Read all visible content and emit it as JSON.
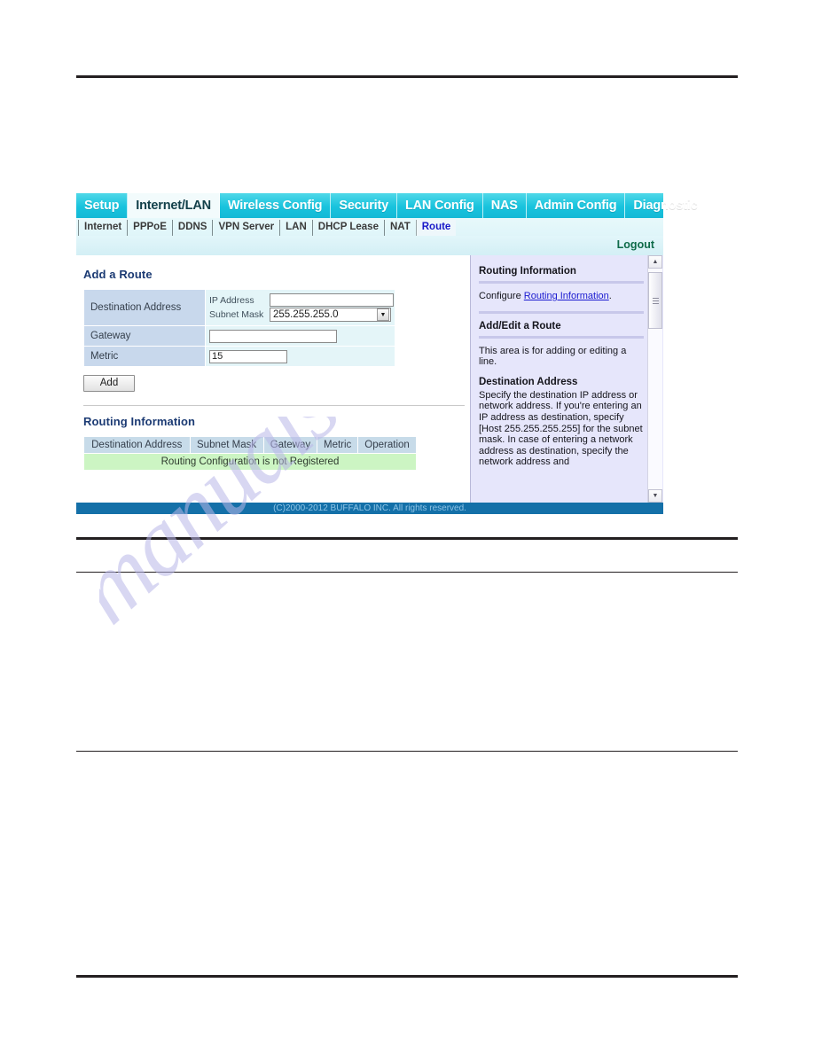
{
  "main_tabs": [
    {
      "label": "Setup",
      "active": false
    },
    {
      "label": "Internet/LAN",
      "active": true
    },
    {
      "label": "Wireless Config",
      "active": false
    },
    {
      "label": "Security",
      "active": false
    },
    {
      "label": "LAN Config",
      "active": false
    },
    {
      "label": "NAS",
      "active": false
    },
    {
      "label": "Admin Config",
      "active": false
    },
    {
      "label": "Diagnostic",
      "active": false
    }
  ],
  "sub_tabs": [
    {
      "label": "Internet",
      "active": false
    },
    {
      "label": "PPPoE",
      "active": false
    },
    {
      "label": "DDNS",
      "active": false
    },
    {
      "label": "VPN Server",
      "active": false
    },
    {
      "label": "LAN",
      "active": false
    },
    {
      "label": "DHCP Lease",
      "active": false
    },
    {
      "label": "NAT",
      "active": false
    },
    {
      "label": "Route",
      "active": true
    }
  ],
  "logout_label": "Logout",
  "add_route": {
    "title": "Add a Route",
    "destination_label": "Destination Address",
    "ip_address_label": "IP Address",
    "ip_address_value": "",
    "subnet_mask_label": "Subnet Mask",
    "subnet_mask_value": "255.255.255.0",
    "gateway_label": "Gateway",
    "gateway_value": "",
    "metric_label": "Metric",
    "metric_value": "15",
    "add_button": "Add"
  },
  "routing_information": {
    "title": "Routing Information",
    "columns": [
      "Destination Address",
      "Subnet Mask",
      "Gateway",
      "Metric",
      "Operation"
    ],
    "empty_message": "Routing Configuration is not Registered"
  },
  "help": {
    "heading_1": "Routing Information",
    "para_1_prefix": "Configure ",
    "para_1_link": "Routing Information",
    "para_1_suffix": ".",
    "heading_2": "Add/Edit a Route",
    "para_2": "This area is for adding or editing a line.",
    "subheading_1": "Destination Address",
    "para_3": "Specify the destination IP address or network address. If you're entering an IP address as destination, specify [Host 255.255.255.255] for the subnet mask. In case of entering a network address as destination, specify the network address and",
    "scroll_up_icon": "scroll-up-arrow",
    "scroll_down_icon": "scroll-down-arrow"
  },
  "footer": {
    "copyright": "(C)2000-2012 BUFFALO INC. All rights reserved."
  },
  "watermark": {
    "text": "manualshive.com"
  },
  "colors": {
    "tab_bar": "#18c3dd",
    "active_subtab_text": "#1818ca",
    "footer_bar": "#1470a8",
    "help_panel": "#e6e6fb",
    "table_label": "#c8d8ec",
    "table_value": "#e4f5f8",
    "empty_row": "#ccf5c3",
    "section_title": "#1b3a73",
    "logout": "#0e6b49"
  }
}
